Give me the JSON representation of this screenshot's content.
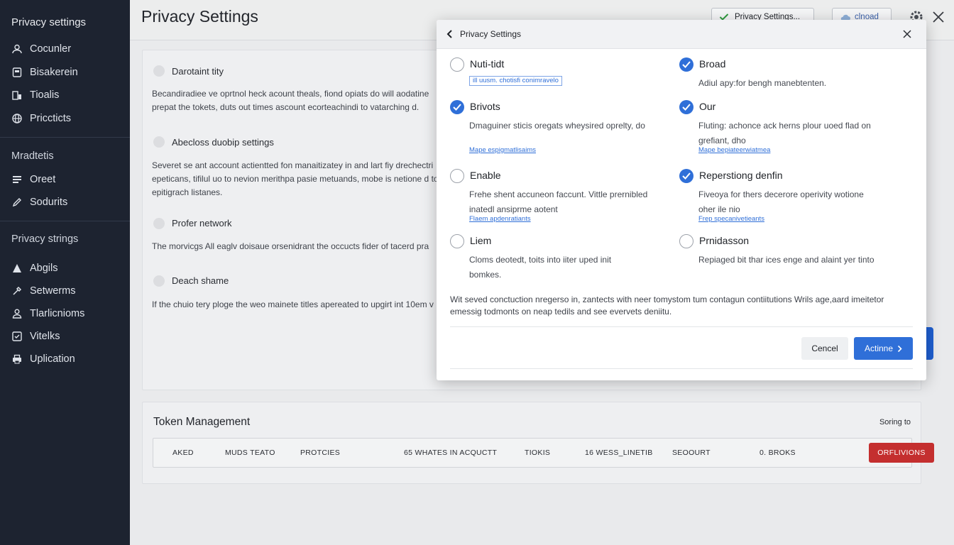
{
  "sidebar": {
    "title": "Privacy settings",
    "group1": [
      {
        "label": "Cocunler",
        "icon": "user-icon"
      },
      {
        "label": "Bisakerein",
        "icon": "folder-icon"
      },
      {
        "label": "Tioalis",
        "icon": "chart-icon"
      },
      {
        "label": "Priccticts",
        "icon": "globe-icon"
      }
    ],
    "heading2": "Mradtetis",
    "group2": [
      {
        "label": "Oreet",
        "icon": "list-icon"
      },
      {
        "label": "Sodurits",
        "icon": "pen-icon"
      }
    ],
    "heading3": "Privacy strings",
    "group3": [
      {
        "label": "Abgils",
        "icon": "triangle-icon"
      },
      {
        "label": "Setwerms",
        "icon": "tools-icon"
      },
      {
        "label": "Tlarlicnioms",
        "icon": "user-group-icon"
      },
      {
        "label": "Vitelks",
        "icon": "check-box-icon"
      },
      {
        "label": "Uplication",
        "icon": "printer-icon"
      }
    ]
  },
  "header": {
    "title": "Privacy Settings",
    "button1": "Privacy Settings...",
    "button2": "clnoad"
  },
  "main": {
    "sections": [
      {
        "title": "Darotaint tity",
        "text": "Becandiradiee ve oprtnol heck acount theals, fiond opiats do will aodatine prepat the tokets, duts out times ascount ecorteachindi to vatarching d."
      },
      {
        "title": "Abecloss duobip settings",
        "text": "Severet se ant account actientted fon manaitizatey in and lart fiy drechectri epeticans, tifilul uo to nevion merithpa pasie metuands, mobe is netione d to epitigrach listanes."
      },
      {
        "title": "Profer network",
        "text": "The morvicgs All eaglv doisaue orsenidrant the occucts fider of tacerd pra"
      },
      {
        "title": "Deach shame",
        "text": "If the chuio tery ploge the weo mainete titles apereated to upgirt int 10em v"
      }
    ]
  },
  "tokens": {
    "title": "Token Management",
    "right_label": "Soring to",
    "columns": [
      "AKED",
      "MUDS TEATO",
      "PROTCIES",
      "65 WHATES IN ACQUCTT",
      "TIOKIS",
      "16 WESS_LINETIB",
      "SEOOURT",
      "0. BROKS"
    ],
    "action": "ORFLIVIONS"
  },
  "modal": {
    "title": "Privacy Settings",
    "options": [
      {
        "label": "Nuti-tidt",
        "checked": false,
        "tag": "ill uusm. chotisfi conimravelo",
        "desc": "",
        "link": ""
      },
      {
        "label": "Broad",
        "checked": true,
        "tag": "",
        "desc": "Adiul apy:for bengh manebtenten.",
        "link": ""
      },
      {
        "label": "Brivots",
        "checked": true,
        "tag": "",
        "desc": "Dmaguiner sticis oregats wheysired oprelty, do",
        "link": "Mape espigmatlisaims"
      },
      {
        "label": "Our",
        "checked": true,
        "tag": "",
        "desc": "Fluting: achonce ack herns plour uoed flad on grefiant, dho",
        "link": "Mape bepiateerwiatmea"
      },
      {
        "label": "Enable",
        "checked": false,
        "tag": "",
        "desc": "Frehe shent accuneon faccunt. Vittle prernibled inatedl ansiprme aotent",
        "link": "Flaem apdenratiants"
      },
      {
        "label": "Reperstiong denfin",
        "checked": true,
        "tag": "",
        "desc": "Fiveoya for thers decerore operivity wotione oher ile nio",
        "link": "Frep specanivetieants"
      },
      {
        "label": "Liem",
        "checked": false,
        "tag": "",
        "desc": "Cloms deotedt, toits into iiter uped init bomkes.",
        "link": ""
      },
      {
        "label": "Prnidasson",
        "checked": false,
        "tag": "",
        "desc": "Repiaged bit thar ices enge and alaint yer tinto",
        "link": ""
      }
    ],
    "note": "Wit seved conctuction nregerso in, zantects with neer tomystom tum contagun contiitutions Wrils age,aard imeitetor emessig todmonts on neap tedils and see evervets deniitu.",
    "cancel": "Cencel",
    "primary": "Actinne"
  }
}
